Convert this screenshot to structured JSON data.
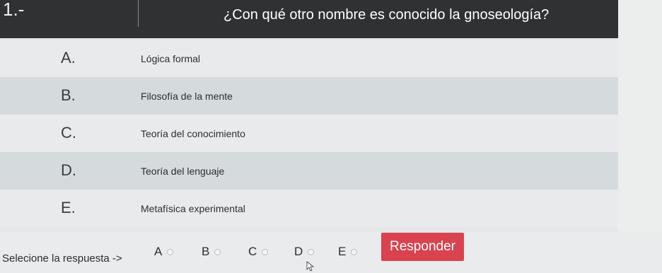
{
  "header": {
    "question_number": "1.-",
    "question": "¿Con qué otro nombre es conocido la gnoseología?"
  },
  "options": [
    {
      "letter": "A.",
      "text": "Lógica formal"
    },
    {
      "letter": "B.",
      "text": "Filosofía de la mente"
    },
    {
      "letter": "C.",
      "text": "Teoría del conocimiento"
    },
    {
      "letter": "D.",
      "text": "Teoría del lenguaje"
    },
    {
      "letter": "E.",
      "text": "Metafísica experimental"
    }
  ],
  "footer": {
    "prompt": "Selecione la respuesta ->",
    "choices": [
      "A",
      "B",
      "C",
      "D",
      "E"
    ],
    "submit_label": "Responder"
  },
  "colors": {
    "header_bg": "#2f3132",
    "button_bg": "#d8434f"
  }
}
